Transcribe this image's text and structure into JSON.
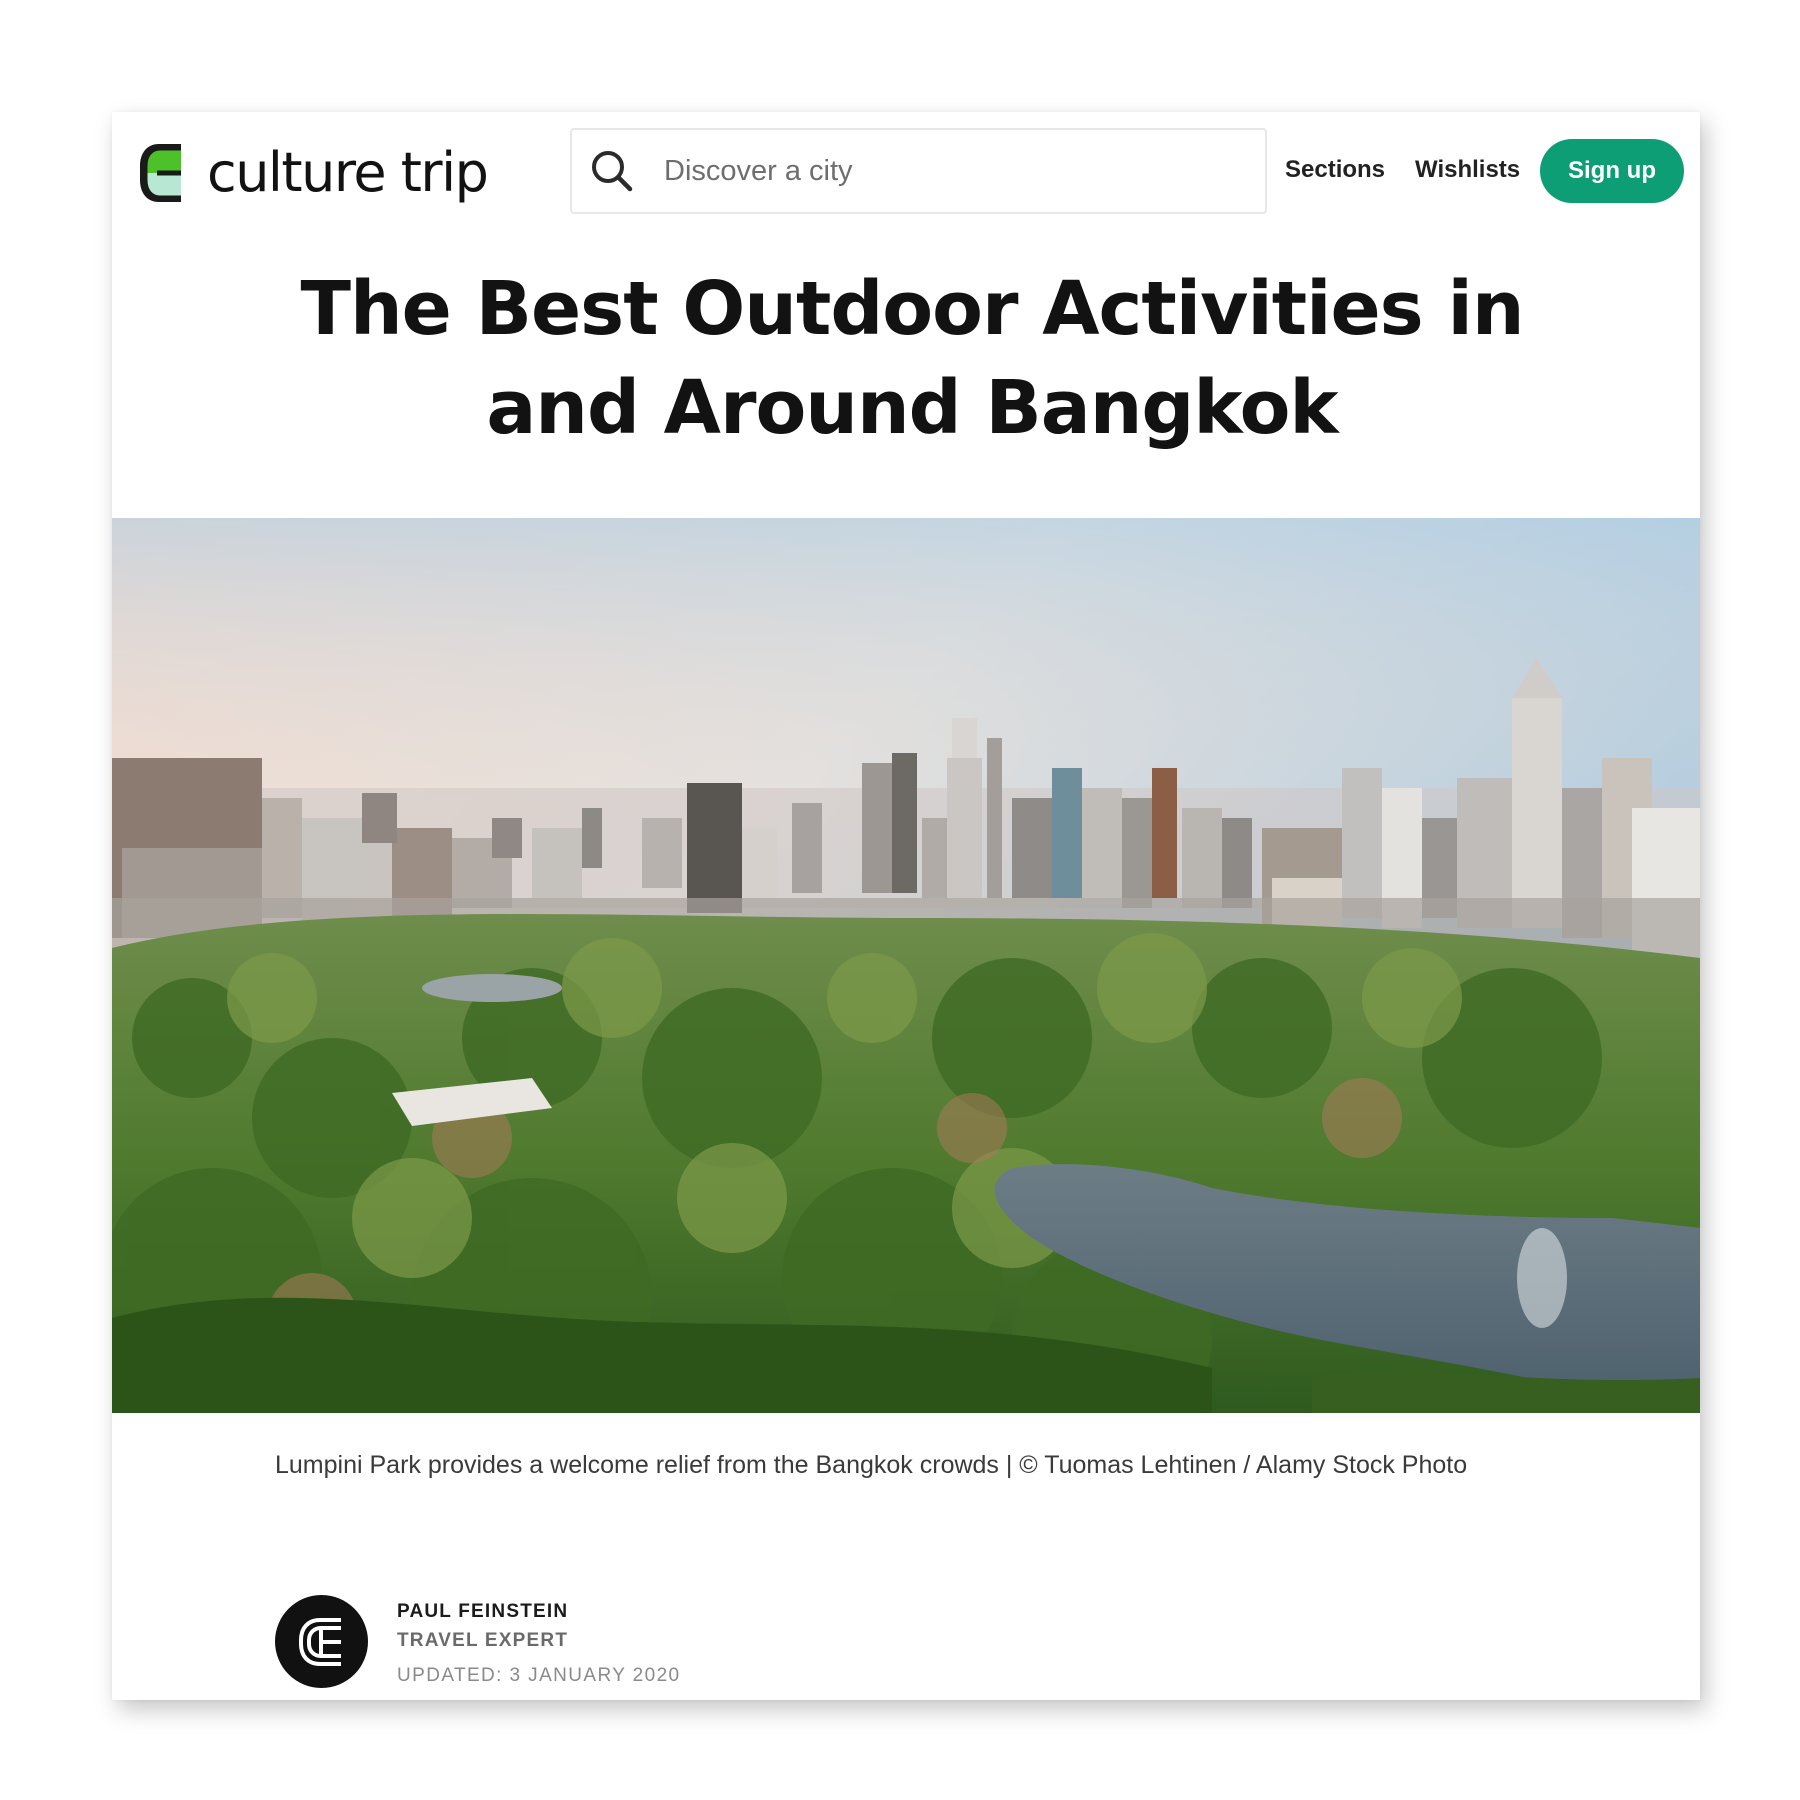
{
  "header": {
    "logo_text": "culture trip",
    "search": {
      "placeholder": "Discover a city",
      "value": ""
    },
    "nav": {
      "sections_label": "Sections",
      "wishlists_label": "Wishlists",
      "signup_label": "Sign up"
    }
  },
  "article": {
    "title_line1": "The Best Outdoor Activities in",
    "title_line2": "and Around Bangkok",
    "hero_image": "aerial-view-lumpini-park-bangkok-skyline",
    "caption": "Lumpini Park provides a welcome relief from the Bangkok crowds | © Tuomas Lehtinen / Alamy Stock Photo",
    "author": {
      "name": "PAUL FEINSTEIN",
      "role": "TRAVEL EXPERT",
      "updated": "UPDATED: 3 JANUARY 2020"
    }
  },
  "colors": {
    "brand_green": "#0d9e76",
    "logo_green": "#4cc12a",
    "logo_mint": "#b8e8d4",
    "title_text": "#121212"
  }
}
